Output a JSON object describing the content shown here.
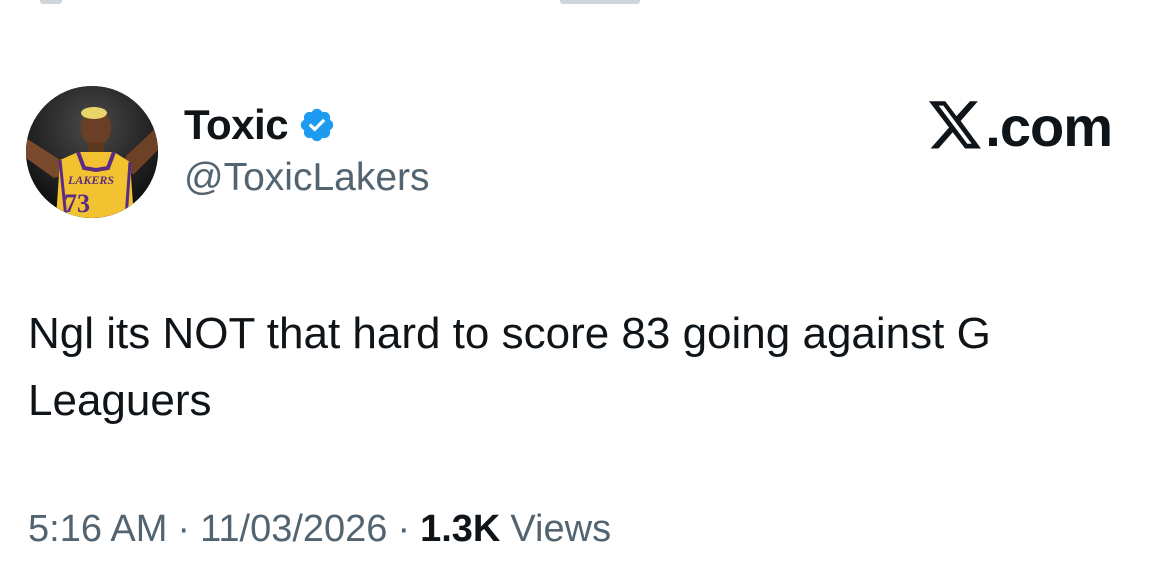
{
  "author": {
    "display_name": "Toxic",
    "handle": "@ToxicLakers",
    "verified": true,
    "avatar_icon": "player-avatar"
  },
  "source": {
    "logo_icon": "x-logo-icon",
    "label": ".com"
  },
  "tweet": {
    "text": "Ngl its NOT that hard to score 83 going against G Leaguers"
  },
  "meta": {
    "time": "5:16 AM",
    "separator": "·",
    "date": "11/03/2026",
    "views_count": "1.3K",
    "views_label": "Views"
  },
  "colors": {
    "text_primary": "#0f1419",
    "text_secondary": "#536471",
    "verified_blue": "#1d9bf0",
    "lakers_gold": "#f2c230"
  }
}
